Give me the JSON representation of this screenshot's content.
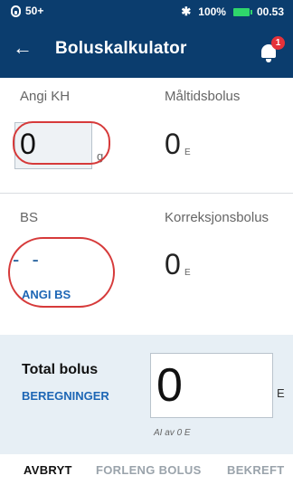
{
  "status_bar": {
    "left_text": "50+",
    "battery_percent": "100%",
    "time": "00.53",
    "icons": [
      "pod-icon",
      "bluetooth-icon",
      "battery-icon"
    ],
    "battery_color": "#2fd66b"
  },
  "header": {
    "back_glyph": "←",
    "title": "Boluskalkulator",
    "notification_count": "1",
    "background": "#0b3d6e"
  },
  "carbs": {
    "label": "Angi KH",
    "value": "0",
    "unit": "g"
  },
  "meal_bolus": {
    "label": "Måltidsbolus",
    "value": "0",
    "unit": "E"
  },
  "bg": {
    "label": "BS",
    "value": "- -",
    "action": "ANGI BS"
  },
  "correction_bolus": {
    "label": "Korreksjonsbolus",
    "value": "0",
    "unit": "E"
  },
  "total": {
    "label": "Total bolus",
    "calc_link": "BEREGNINGER",
    "value": "0",
    "unit": "E",
    "note": "AI av 0 E"
  },
  "footer": {
    "cancel": "AVBRYT",
    "extend": "FORLENG BOLUS",
    "confirm": "BEKREFT"
  },
  "colors": {
    "accent": "#1d66b5",
    "highlight": "#d63a3a",
    "disabled": "#9aa3ab"
  }
}
